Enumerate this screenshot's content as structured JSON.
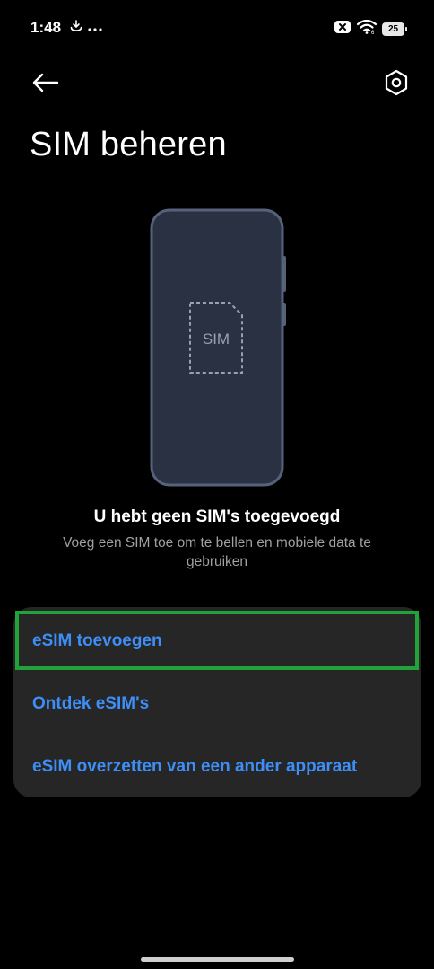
{
  "status_bar": {
    "time": "1:48",
    "battery_level": "25",
    "left_icons": [
      "download-status-icon",
      "more-dots-icon"
    ],
    "right_icons": [
      "no-sim-icon",
      "wifi-icon",
      "battery-icon"
    ]
  },
  "header": {
    "title": "SIM beheren",
    "back_icon": "arrow-left-icon",
    "settings_icon": "hexagon-settings-icon"
  },
  "illustration": {
    "sim_label": "SIM"
  },
  "empty_state": {
    "title": "U hebt geen SIM's toegevoegd",
    "subtitle": "Voeg een SIM toe om te bellen en mobiele data te gebruiken"
  },
  "options": [
    {
      "label": "eSIM toevoegen"
    },
    {
      "label": "Ontdek eSIM's"
    },
    {
      "label": "eSIM overzetten van een ander apparaat"
    }
  ],
  "colors": {
    "background": "#000000",
    "card": "#262626",
    "accent": "#3d8ef7",
    "highlight": "#22a33a",
    "phone_body": "#293142",
    "phone_border": "#56617a"
  }
}
